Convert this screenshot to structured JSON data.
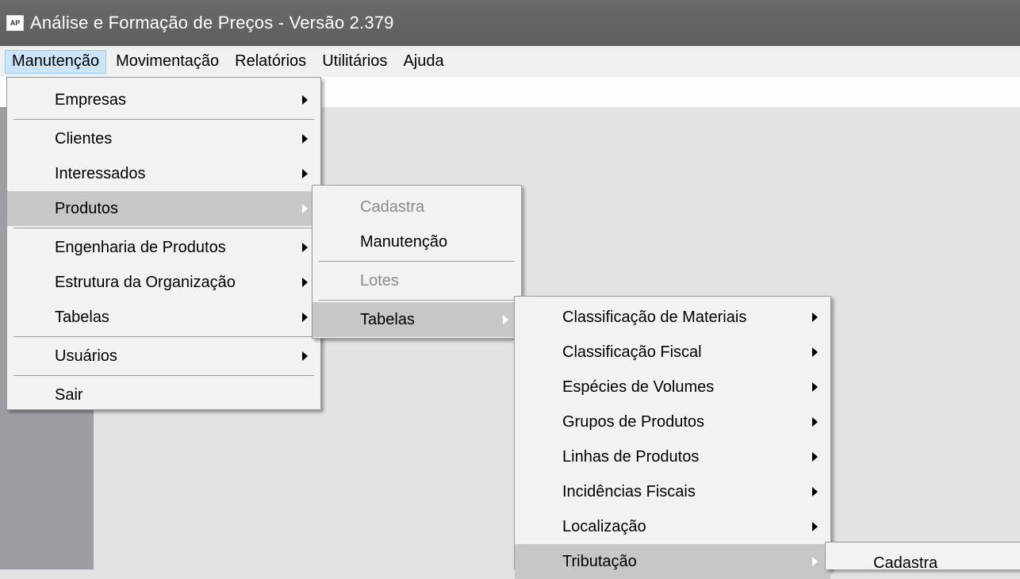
{
  "window": {
    "icon_text": "AP",
    "title": "Análise e Formação de Preços - Versão 2.379"
  },
  "menubar": {
    "items": [
      "Manutenção",
      "Movimentação",
      "Relatórios",
      "Utilitários",
      "Ajuda"
    ]
  },
  "menu_manutencao": {
    "empresas": "Empresas",
    "clientes": "Clientes",
    "interessados": "Interessados",
    "produtos": "Produtos",
    "engenharia": "Engenharia de Produtos",
    "estrutura": "Estrutura da Organização",
    "tabelas": "Tabelas",
    "usuarios": "Usuários",
    "sair": "Sair"
  },
  "menu_produtos": {
    "cadastra": "Cadastra",
    "manutencao": "Manutenção",
    "lotes": "Lotes",
    "tabelas": "Tabelas"
  },
  "menu_tabelas": {
    "items": [
      "Classificação de Materiais",
      "Classificação Fiscal",
      "Espécies de Volumes",
      "Grupos de Produtos",
      "Linhas de Produtos",
      "Incidências Fiscais",
      "Localização",
      "Tributação"
    ]
  },
  "menu_tributacao": {
    "cadastra": "Cadastra"
  }
}
